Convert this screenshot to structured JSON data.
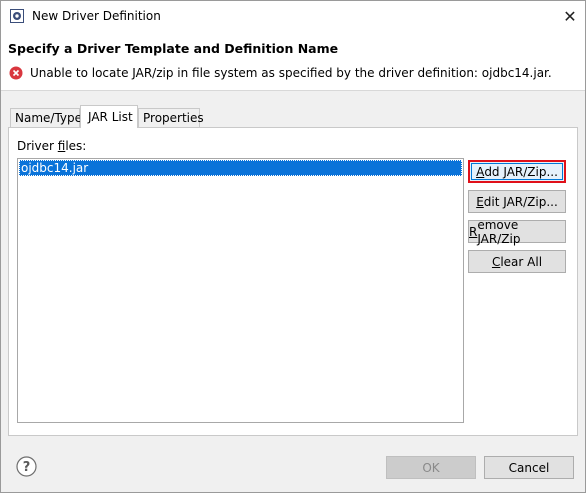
{
  "window": {
    "title": "New Driver Definition",
    "close_glyph": "✕"
  },
  "header": {
    "title": "Specify a Driver Template and Definition Name",
    "error_message": "Unable to locate JAR/zip in file system as specified by the driver definition: ojdbc14.jar."
  },
  "tabs": [
    {
      "label": "Name/Type",
      "active": false
    },
    {
      "label": "JAR List",
      "active": true
    },
    {
      "label": "Properties",
      "active": false
    }
  ],
  "jar_list": {
    "label_prefix": "Driver ",
    "label_mnemonic": "f",
    "label_suffix": "iles:",
    "files": [
      "ojdbc14.jar"
    ],
    "buttons": {
      "add": {
        "pre": "",
        "mn": "A",
        "post": "dd JAR/Zip..."
      },
      "edit": {
        "pre": "",
        "mn": "E",
        "post": "dit JAR/Zip..."
      },
      "remove": {
        "pre": "",
        "mn": "R",
        "post": "emove JAR/Zip"
      },
      "clear": {
        "pre": "",
        "mn": "C",
        "post": "lear All"
      }
    }
  },
  "footer": {
    "ok_label": "OK",
    "cancel_label": "Cancel",
    "help_glyph": "?"
  },
  "colors": {
    "selection": "#0a73d9",
    "highlight_border": "#e0101a",
    "error": "#d9363e"
  },
  "icons": {
    "app": "eclipse-gear-icon",
    "error": "error-x-icon",
    "help": "help-question-icon",
    "close": "close-icon"
  }
}
